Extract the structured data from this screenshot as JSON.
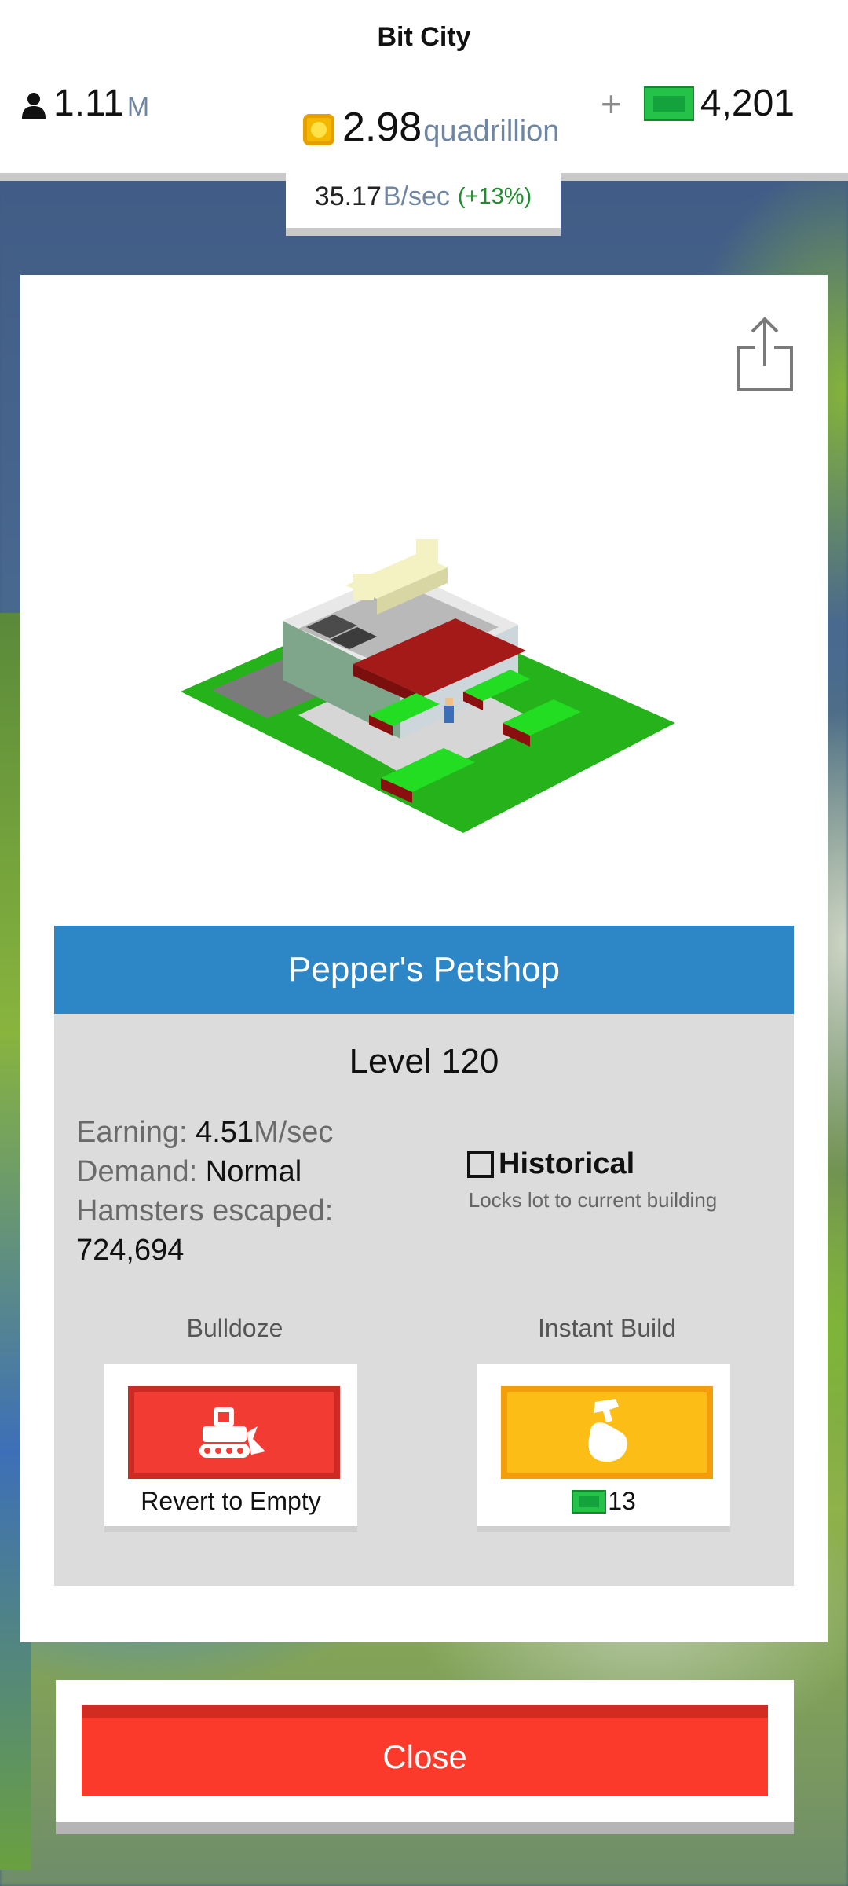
{
  "header": {
    "title": "Bit City",
    "population": {
      "value": "1.11",
      "unit": "M",
      "icon": "person-icon"
    },
    "coins": {
      "value": "2.98",
      "unit": "quadrillion",
      "icon": "coin-icon"
    },
    "bucks": {
      "plus": "+",
      "value": "4,201",
      "icon": "bill-icon"
    },
    "rate": {
      "value": "35.17",
      "unit": "B/sec",
      "percent": "(+13%)"
    }
  },
  "building": {
    "name": "Pepper's Petshop",
    "level": "Level 120",
    "earning_label": "Earning:",
    "earning_value": "4.51",
    "earning_unit": "M/sec",
    "demand_label": "Demand:",
    "demand_value": "Normal",
    "escaped_label": "Hamsters escaped:",
    "escaped_value": "724,694",
    "historical_label": "Historical",
    "historical_checked": false,
    "historical_sub": "Locks lot to current building"
  },
  "actions": {
    "bulldoze_label": "Bulldoze",
    "bulldoze_caption": "Revert to Empty",
    "instant_label": "Instant Build",
    "instant_cost": "13"
  },
  "close_label": "Close",
  "colors": {
    "accent_blue": "#2d86c5",
    "danger_red": "#f23c33",
    "build_yellow": "#fbbd16",
    "money_green": "#25c24a"
  }
}
